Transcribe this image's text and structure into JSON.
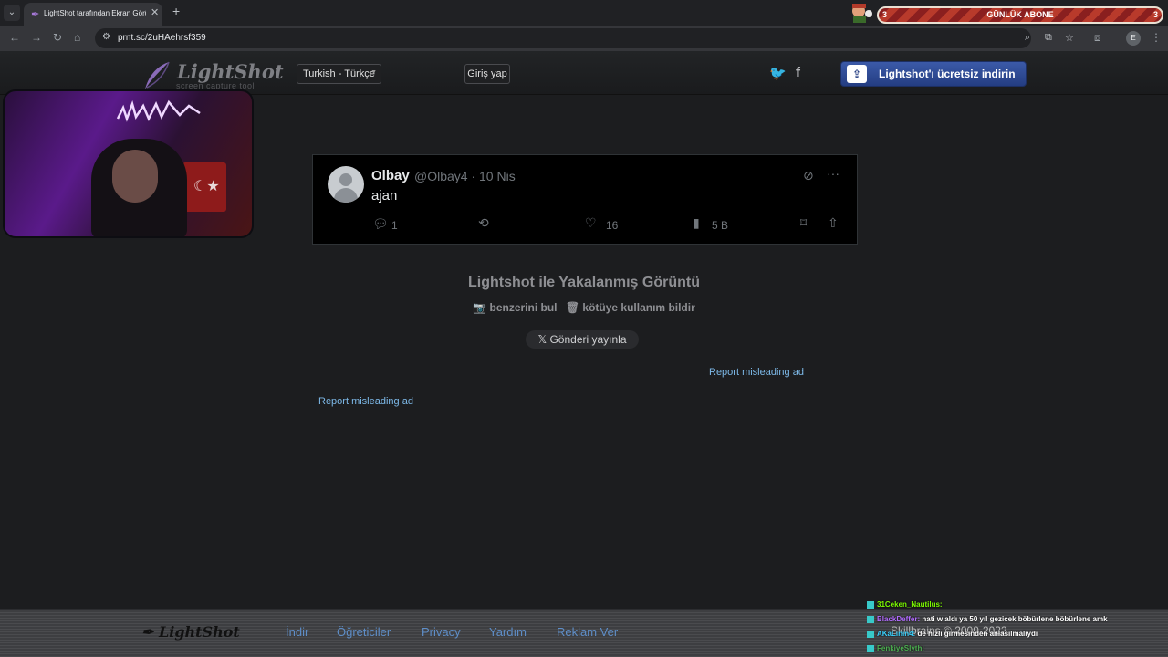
{
  "browser": {
    "tab_title": "LightShot tarafından Ekran Görüntüsü",
    "tab_close": "✕",
    "new_tab": "+",
    "url": "prnt.sc/2uHAehrsf359"
  },
  "overlay": {
    "sub_left_count": "3",
    "sub_title": "GÜNLÜK ABONE",
    "sub_right_count": "3"
  },
  "header": {
    "logo_text": "LightShot",
    "logo_sub": "screen capture tool",
    "language": "Turkish - Türkçe",
    "login": "Giriş yap",
    "twitter_icon_glyph": "🐦",
    "facebook_icon_glyph": "f",
    "download": "Lightshot'ı ücretsiz indirin"
  },
  "tweet": {
    "name": "Olbay",
    "handle_date": "@Olbay4 · 10 Nis",
    "text": "ajan",
    "replies": "1",
    "likes": "16",
    "views": "5 B"
  },
  "capture": {
    "title": "Lightshot ile Yakalanmış Görüntü",
    "find_similar": "📷 benzerini bul",
    "report_abuse": "🗑 kötüye kullanım bildir",
    "post_button": "𝕏 Gönderi yayınla",
    "report_ad_1": "Report misleading ad",
    "report_ad_2": "Report misleading ad"
  },
  "footer": {
    "logo": "LightShot",
    "links": [
      "İndir",
      "Öğreticiler",
      "Privacy",
      "Yardım",
      "Reklam Ver"
    ],
    "copyright": "Skillbrains © 2009-2022"
  },
  "chat": [
    {
      "user": "31Ceken_Nautilus:",
      "msg": "",
      "color": "#7cfc00"
    },
    {
      "user": "BlackDeffer:",
      "msg": "nati w aldı ya 50 yıl gezicek böbürlene böbürlene amk",
      "color": "#b26bff"
    },
    {
      "user": "AKaLinin4:",
      "msg": "de hızlı girmesinden anlasılmalıydı",
      "color": "#3ad3ff"
    },
    {
      "user": "FenkiyeSlyth:",
      "msg": "",
      "color": "#4caf50"
    }
  ],
  "colors": {
    "accent_blue": "#3b5aa8",
    "link_blue": "#7db9e8",
    "background": "#1c1d1f"
  }
}
